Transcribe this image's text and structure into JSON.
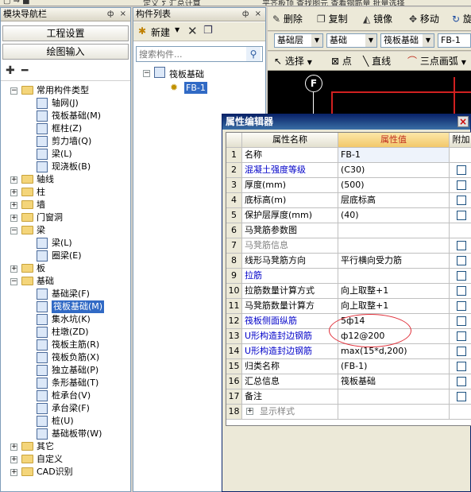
{
  "topbar": {
    "left_fragment": "▢ ⇒ ■",
    "mid_fragment": "定义  Σ 汇总计算",
    "right_fragment": "平齐板顶  查找图元  查看钢筋量  批量选择"
  },
  "left_panel": {
    "title": "模块导航栏",
    "title_buttons": "ф ×",
    "buttons": [
      "工程设置",
      "绘图输入"
    ],
    "toolbar_icons": [
      "expand-all-icon",
      "collapse-all-icon"
    ],
    "tree": [
      {
        "label": "常用构件类型",
        "level": 0,
        "type": "folder",
        "expanded": true
      },
      {
        "label": "轴网(J)",
        "level": 1,
        "type": "item"
      },
      {
        "label": "筏板基础(M)",
        "level": 1,
        "type": "item"
      },
      {
        "label": "框柱(Z)",
        "level": 1,
        "type": "item"
      },
      {
        "label": "剪力墙(Q)",
        "level": 1,
        "type": "item"
      },
      {
        "label": "梁(L)",
        "level": 1,
        "type": "item"
      },
      {
        "label": "现浇板(B)",
        "level": 1,
        "type": "item"
      },
      {
        "label": "轴线",
        "level": 0,
        "type": "folder",
        "expanded": false
      },
      {
        "label": "柱",
        "level": 0,
        "type": "folder",
        "expanded": false
      },
      {
        "label": "墙",
        "level": 0,
        "type": "folder",
        "expanded": false
      },
      {
        "label": "门窗洞",
        "level": 0,
        "type": "folder",
        "expanded": false
      },
      {
        "label": "梁",
        "level": 0,
        "type": "folder",
        "expanded": true
      },
      {
        "label": "梁(L)",
        "level": 1,
        "type": "item"
      },
      {
        "label": "圈梁(E)",
        "level": 1,
        "type": "item"
      },
      {
        "label": "板",
        "level": 0,
        "type": "folder",
        "expanded": false
      },
      {
        "label": "基础",
        "level": 0,
        "type": "folder",
        "expanded": true
      },
      {
        "label": "基础梁(F)",
        "level": 1,
        "type": "item"
      },
      {
        "label": "筏板基础(M)",
        "level": 1,
        "type": "item",
        "selected": true
      },
      {
        "label": "集水坑(K)",
        "level": 1,
        "type": "item"
      },
      {
        "label": "柱墩(ZD)",
        "level": 1,
        "type": "item"
      },
      {
        "label": "筏板主筋(R)",
        "level": 1,
        "type": "item"
      },
      {
        "label": "筏板负筋(X)",
        "level": 1,
        "type": "item"
      },
      {
        "label": "独立基础(P)",
        "level": 1,
        "type": "item"
      },
      {
        "label": "条形基础(T)",
        "level": 1,
        "type": "item"
      },
      {
        "label": "桩承台(V)",
        "level": 1,
        "type": "item"
      },
      {
        "label": "承台梁(F)",
        "level": 1,
        "type": "item"
      },
      {
        "label": "桩(U)",
        "level": 1,
        "type": "item"
      },
      {
        "label": "基础板带(W)",
        "level": 1,
        "type": "item"
      },
      {
        "label": "其它",
        "level": 0,
        "type": "folder",
        "expanded": false
      },
      {
        "label": "自定义",
        "level": 0,
        "type": "folder",
        "expanded": false
      },
      {
        "label": "CAD识别",
        "level": 0,
        "type": "folder",
        "expanded": false
      }
    ]
  },
  "component_list": {
    "title": "构件列表",
    "title_buttons": "ф ×",
    "new_label": "新建",
    "search_placeholder": "搜索构件...",
    "tree_root": "筏板基础",
    "tree_child": "FB-1"
  },
  "right_toolbar": {
    "delete": "删除",
    "copy": "复制",
    "mirror": "镜像",
    "move": "移动",
    "rotate": "旋",
    "layer_combo": "基础层",
    "type_combo": "基础",
    "comp_combo": "筏板基础",
    "name_combo": "FB-1",
    "select": "选择",
    "point": "点",
    "line": "直线",
    "arc": "三点画弧"
  },
  "canvas": {
    "axis_label": "F"
  },
  "property_editor": {
    "title": "属性编辑器",
    "close": "×",
    "headers": [
      "属性名称",
      "属性值",
      "附加"
    ],
    "rows": [
      {
        "num": "1",
        "name": "名称",
        "value": "FB-1",
        "style": "normal",
        "check": false
      },
      {
        "num": "2",
        "name": "混凝土强度等级",
        "value": "(C30)",
        "style": "blue",
        "check": true
      },
      {
        "num": "3",
        "name": "厚度(mm)",
        "value": "(500)",
        "style": "normal",
        "check": true
      },
      {
        "num": "4",
        "name": "底标高(m)",
        "value": "层底标高",
        "style": "normal",
        "check": true
      },
      {
        "num": "5",
        "name": "保护层厚度(mm)",
        "value": "(40)",
        "style": "normal",
        "check": true
      },
      {
        "num": "6",
        "name": "马凳筋参数图",
        "value": "",
        "style": "normal",
        "check": false
      },
      {
        "num": "7",
        "name": "马凳筋信息",
        "value": "",
        "style": "gray",
        "check": true
      },
      {
        "num": "8",
        "name": "线形马凳筋方向",
        "value": "平行横向受力筋",
        "style": "normal",
        "check": true
      },
      {
        "num": "9",
        "name": "拉筋",
        "value": "",
        "style": "blue",
        "check": true
      },
      {
        "num": "10",
        "name": "拉筋数量计算方式",
        "value": "向上取整+1",
        "style": "normal",
        "check": true
      },
      {
        "num": "11",
        "name": "马凳筋数量计算方",
        "value": "向上取整+1",
        "style": "normal",
        "check": true
      },
      {
        "num": "12",
        "name": "筏板侧面纵筋",
        "value": "5ф14",
        "style": "blue",
        "check": true
      },
      {
        "num": "13",
        "name": "U形构造封边钢筋",
        "value": "ф12@200",
        "style": "blue",
        "check": true
      },
      {
        "num": "14",
        "name": "U形构造封边钢筋",
        "value": "max(15*d,200)",
        "style": "blue",
        "check": true
      },
      {
        "num": "15",
        "name": "归类名称",
        "value": "(FB-1)",
        "style": "normal",
        "check": true
      },
      {
        "num": "16",
        "name": "汇总信息",
        "value": "筏板基础",
        "style": "normal",
        "check": true
      },
      {
        "num": "17",
        "name": "备注",
        "value": "",
        "style": "normal",
        "check": true
      },
      {
        "num": "18",
        "name": "显示样式",
        "value": "",
        "style": "gray",
        "check": false,
        "expander": "+"
      }
    ]
  },
  "colors": {
    "selection": "#316ac5",
    "accent_blue": "#0000c8",
    "annotation": "#e0303a",
    "title_bar": "#0a246a"
  }
}
